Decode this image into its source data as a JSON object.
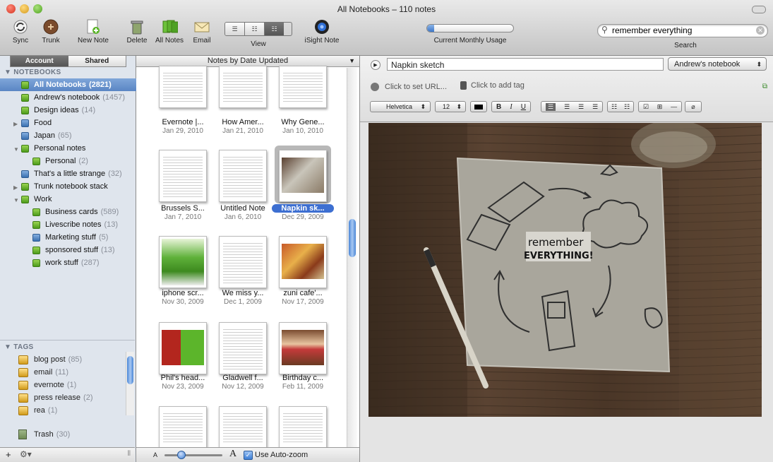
{
  "window": {
    "title": "All Notebooks – 110 notes"
  },
  "toolbar": {
    "sync": "Sync",
    "trunk": "Trunk",
    "new_note": "New Note",
    "delete": "Delete",
    "all_notes": "All Notes",
    "email": "Email",
    "view": "View",
    "isight": "iSight Note",
    "usage_label": "Current Monthly Usage",
    "usage_fraction": 0.08,
    "search_label": "Search",
    "search_value": "remember everything"
  },
  "sidebar": {
    "tabs": [
      "Account",
      "Shared"
    ],
    "notebooks_header": "NOTEBOOKS",
    "notebooks": [
      {
        "label": "All Notebooks",
        "count": "(2821)"
      },
      {
        "label": "Andrew's notebook",
        "count": "(1457)"
      },
      {
        "label": "Design ideas",
        "count": "(14)"
      },
      {
        "label": "Food",
        "count": ""
      },
      {
        "label": "Japan",
        "count": "(65)"
      },
      {
        "label": "Personal notes",
        "count": ""
      },
      {
        "label": "Personal",
        "count": "(2)"
      },
      {
        "label": "That's a little strange",
        "count": "(32)"
      },
      {
        "label": "Trunk notebook stack",
        "count": ""
      },
      {
        "label": "Work",
        "count": ""
      },
      {
        "label": "Business cards",
        "count": "(589)"
      },
      {
        "label": "Livescribe notes",
        "count": "(13)"
      },
      {
        "label": "Marketing stuff",
        "count": "(5)"
      },
      {
        "label": "sponsored stuff",
        "count": "(13)"
      },
      {
        "label": "work stuff",
        "count": "(287)"
      }
    ],
    "tags_header": "TAGS",
    "tags": [
      {
        "label": "blog post",
        "count": "(85)"
      },
      {
        "label": "email",
        "count": "(11)"
      },
      {
        "label": "evernote",
        "count": "(1)"
      },
      {
        "label": "press release",
        "count": "(2)"
      },
      {
        "label": "rea",
        "count": "(1)"
      }
    ],
    "trash": {
      "label": "Trash",
      "count": "(30)"
    }
  },
  "notes_list": {
    "header": "Notes by Date Updated",
    "notes": [
      {
        "title": "Evernote |...",
        "date": "Jan 29, 2010"
      },
      {
        "title": "How Amer...",
        "date": "Jan 21, 2010"
      },
      {
        "title": "Why Gene...",
        "date": "Jan 10, 2010"
      },
      {
        "title": "Brussels S...",
        "date": "Jan 7, 2010"
      },
      {
        "title": "Untitled Note",
        "date": "Jan 6, 2010"
      },
      {
        "title": "Napkin sk...",
        "date": "Dec 29, 2009"
      },
      {
        "title": "iphone scr...",
        "date": "Nov 30, 2009"
      },
      {
        "title": "We miss y...",
        "date": "Dec 1, 2009"
      },
      {
        "title": "zuni cafe'...",
        "date": "Nov 17, 2009"
      },
      {
        "title": "Phil's head...",
        "date": "Nov 23, 2009"
      },
      {
        "title": "Gladwell f...",
        "date": "Nov 12, 2009"
      },
      {
        "title": "Birthday c...",
        "date": "Feb 11, 2009"
      }
    ],
    "auto_zoom": "Use Auto-zoom"
  },
  "note": {
    "title": "Napkin sketch",
    "notebook": "Andrew's notebook",
    "url_placeholder": "Click to set URL...",
    "tag_placeholder": "Click to add tag",
    "font": "Helvetica",
    "size": "12",
    "napkin_text1": "remember",
    "napkin_text2": "EVERYTHING!"
  }
}
